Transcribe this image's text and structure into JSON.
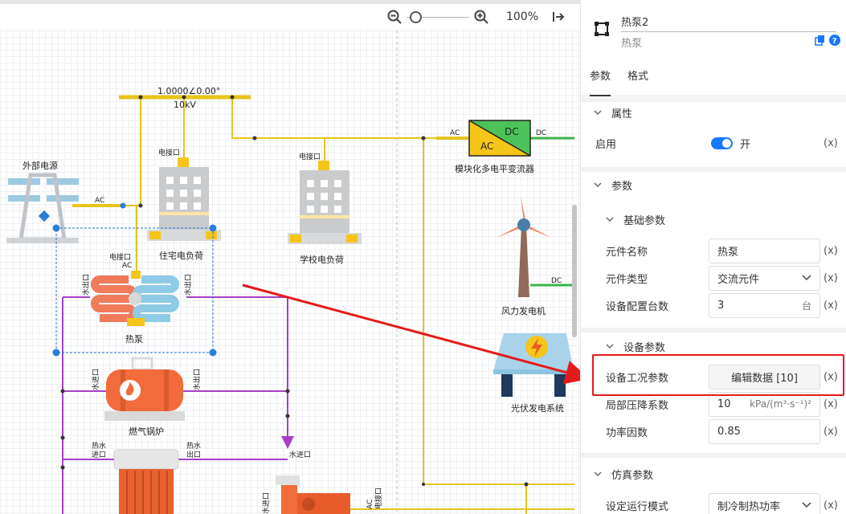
{
  "toolbar": {
    "zoom": "100%"
  },
  "diagram": {
    "bus_value": "1.0000∠0.00°",
    "bus_kv": "10kV",
    "external_source": "外部电源",
    "ac": "AC",
    "dc": "DC",
    "residential": "住宅电负荷",
    "school": "学校电负荷",
    "elec_port": "电接口",
    "converter": "模块化多电平变流器",
    "wind": "风力发电机",
    "pv": "光伏发电系统",
    "heatpump": "热泵",
    "boiler": "燃气锅炉",
    "water_in": "水进口",
    "water_out": "水出口",
    "hot_water_in": "热水进口",
    "hot_water_out": "热水出口",
    "hot_line1": "热水",
    "hot_line2": "进口",
    "hot_line3": "热水",
    "hot_line4": "出口"
  },
  "panel": {
    "title": "热泵2",
    "subtitle": "热泵",
    "tabs": [
      "参数",
      "格式"
    ],
    "sections": {
      "attr": "属性",
      "params": "参数",
      "basic": "基础参数",
      "device": "设备参数",
      "sim": "仿真参数"
    },
    "enable": {
      "label": "启用",
      "state": "开"
    },
    "fields": {
      "name": {
        "label": "元件名称",
        "value": "热泵"
      },
      "type": {
        "label": "元件类型",
        "value": "交流元件"
      },
      "count": {
        "label": "设备配置台数",
        "value": "3",
        "unit": "台"
      },
      "condition": {
        "label": "设备工况参数",
        "value": "编辑数据 [10]"
      },
      "pressure": {
        "label": "局部压降系数",
        "value": "10",
        "unit": "kPa/(m³·s⁻¹)²"
      },
      "pf": {
        "label": "功率因数",
        "value": "0.85"
      },
      "mode": {
        "label": "设定运行模式",
        "value": "制冷制热功率"
      }
    },
    "xfn": "(x)"
  },
  "colors": {
    "accent": "#1677ff",
    "annotation": "#e51a1a",
    "bus": "#e8c41c",
    "pipe": "#a640c8",
    "dcline": "#3ab54a"
  }
}
